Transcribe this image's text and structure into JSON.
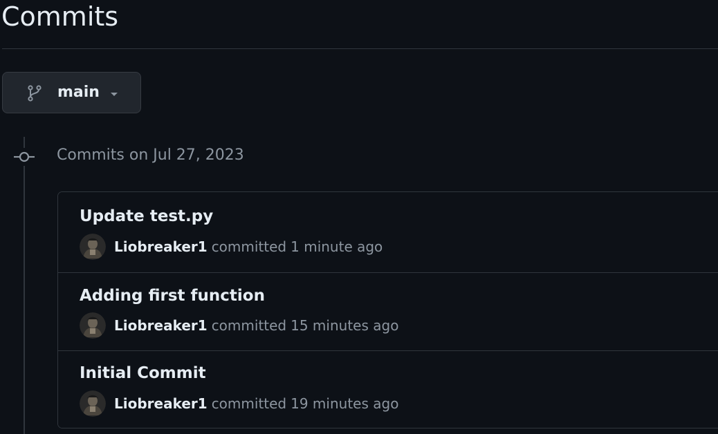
{
  "page": {
    "title": "Commits"
  },
  "branch": {
    "label": "main",
    "icon": "git-branch-icon"
  },
  "group": {
    "heading": "Commits on Jul 27, 2023",
    "icon": "git-commit-icon"
  },
  "commits": [
    {
      "title": "Update test.py",
      "author": "Liobreaker1",
      "verb": "committed",
      "time": "1 minute ago"
    },
    {
      "title": "Adding first function",
      "author": "Liobreaker1",
      "verb": "committed",
      "time": "15 minutes ago"
    },
    {
      "title": "Initial Commit",
      "author": "Liobreaker1",
      "verb": "committed",
      "time": "19 minutes ago"
    }
  ],
  "colors": {
    "background": "#0d1117",
    "border": "#30363d",
    "button_bg": "#21262d",
    "text_primary": "#e6edf3",
    "text_muted": "#8d96a0"
  }
}
